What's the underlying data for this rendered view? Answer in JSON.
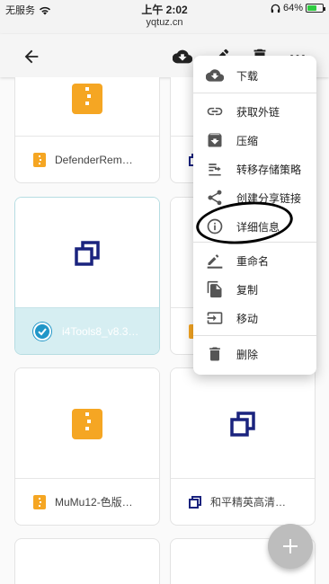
{
  "status": {
    "carrier": "无服务",
    "time": "上午 2:02",
    "url": "yqtuz.cn",
    "battery": "64%",
    "battery_level": 0.64
  },
  "appbar": {
    "icons": [
      "arrow-back-icon",
      "cloud-download-icon",
      "pencil-icon",
      "trash-icon",
      "more-horizontal-icon"
    ]
  },
  "files": [
    {
      "name": "DefenderRem…",
      "type": "archive"
    },
    {
      "name": "",
      "type": "app"
    },
    {
      "name": "i4Tools8_v8.3…",
      "type": "app",
      "selected": true
    },
    {
      "name": "",
      "type": "archive"
    },
    {
      "name": "MuMu12-色版…",
      "type": "archive"
    },
    {
      "name": "和平精英高清…",
      "type": "app"
    }
  ],
  "menu": {
    "items": [
      {
        "label": "下载",
        "icon": "cloud-download-icon"
      },
      {
        "label": "获取外链",
        "icon": "link-icon"
      },
      {
        "label": "压缩",
        "icon": "archive-box-icon"
      },
      {
        "label": "转移存储策略",
        "icon": "storage-transfer-icon"
      },
      {
        "label": "创建分享链接",
        "icon": "share-icon"
      },
      {
        "label": "详细信息",
        "icon": "info-icon"
      },
      {
        "label": "重命名",
        "icon": "rename-icon"
      },
      {
        "label": "复制",
        "icon": "copy-icon"
      },
      {
        "label": "移动",
        "icon": "move-icon"
      },
      {
        "label": "删除",
        "icon": "delete-icon"
      }
    ]
  },
  "colors": {
    "archive": "#f5a623",
    "app": "#1a237e",
    "selected_bg": "#d6eef2",
    "check": "#2196c8"
  }
}
